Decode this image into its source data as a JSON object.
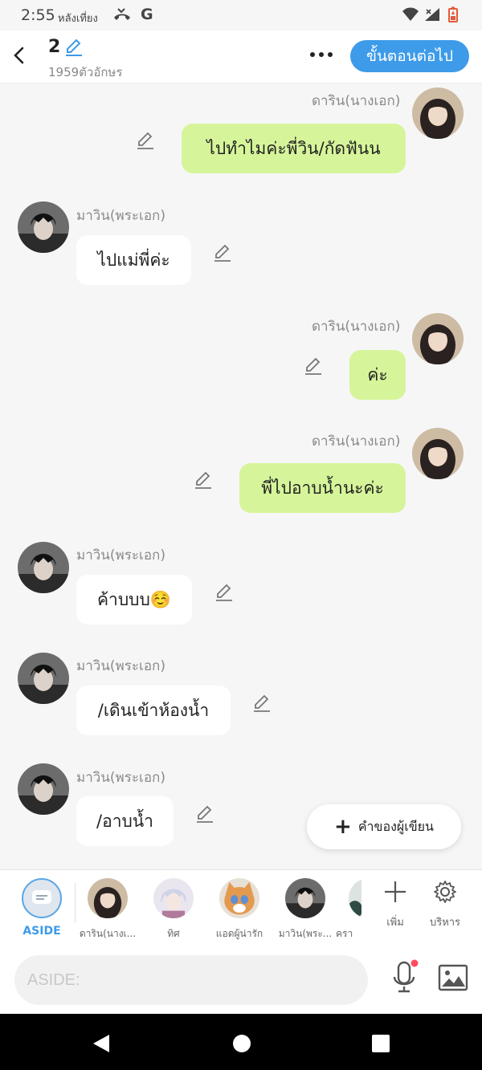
{
  "status_bar": {
    "time": "2:55",
    "ampm": "หลังเที่ยง"
  },
  "header": {
    "title": "2",
    "char_count": "1959ตัวอักษร",
    "next_label": "ขั้นตอนต่อไป"
  },
  "messages": [
    {
      "side": "me",
      "name": "ดาริน(นางเอก)",
      "text": "ไปทำไมค่ะพี่วิน/กัดฟันน"
    },
    {
      "side": "other",
      "name": "มาวิน(พระเอก)",
      "text": "ไปแม่พี่ค่ะ"
    },
    {
      "side": "me",
      "name": "ดาริน(นางเอก)",
      "text": "ค่ะ"
    },
    {
      "side": "me",
      "name": "ดาริน(นางเอก)",
      "text": "พี่ไปอาบน้ำนะค่ะ"
    },
    {
      "side": "other",
      "name": "มาวิน(พระเอก)",
      "text": "ค้าบบบ☺️"
    },
    {
      "side": "other",
      "name": "มาวิน(พระเอก)",
      "text": "/เดินเข้าห้องน้ำ"
    },
    {
      "side": "other",
      "name": "มาวิน(พระเอก)",
      "text": "/อาบน้ำ"
    }
  ],
  "author_note_label": "คำของผู้เขียน",
  "characters": [
    {
      "label": "ASIDE"
    },
    {
      "label": "ดาริน(นางเ..."
    },
    {
      "label": "ทิศ"
    },
    {
      "label": "แอดผู้น่ารัก"
    },
    {
      "label": "มาวิน(พระ..."
    },
    {
      "label": "ครา"
    }
  ],
  "tools": {
    "add_label": "เพิ่ม",
    "manage_label": "บริหาร"
  },
  "input": {
    "placeholder": "ASIDE:",
    "value": ""
  },
  "colors": {
    "accent": "#3d9be9",
    "my_bubble": "#d6f59a",
    "other_bubble": "#ffffff",
    "background": "#f6f6f6",
    "mic_dot": "#ff4d5e"
  }
}
